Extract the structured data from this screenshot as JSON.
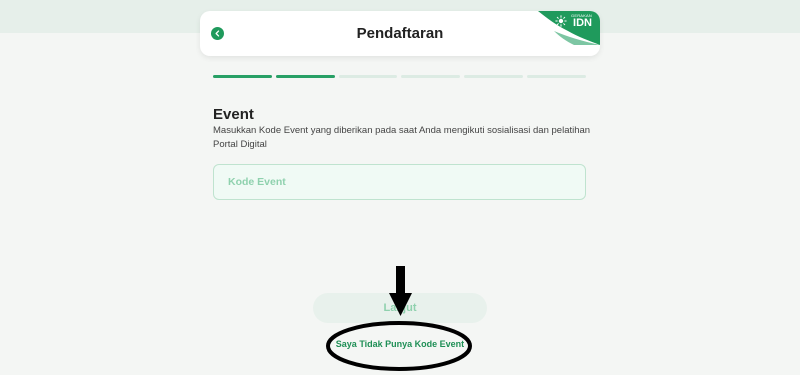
{
  "header": {
    "title": "Pendaftaran",
    "brand_small": "GERAKAN",
    "brand_big": "IDN"
  },
  "progress": {
    "total_steps": 6,
    "completed_steps": 2
  },
  "event": {
    "title": "Event",
    "description": "Masukkan Kode Event yang diberikan pada saat Anda mengikuti sosialisasi dan pelatihan Portal Digital",
    "input_placeholder": "Kode Event",
    "input_value": ""
  },
  "actions": {
    "next_label": "Lanjut",
    "no_code_label": "Saya Tidak Punya Kode Event"
  },
  "colors": {
    "primary": "#1f9a5c",
    "light_green": "#8fd1ae",
    "background": "#f4f6f4"
  },
  "icons": [
    "chevron-left-icon",
    "sun-logo-icon",
    "arrow-down-icon"
  ]
}
